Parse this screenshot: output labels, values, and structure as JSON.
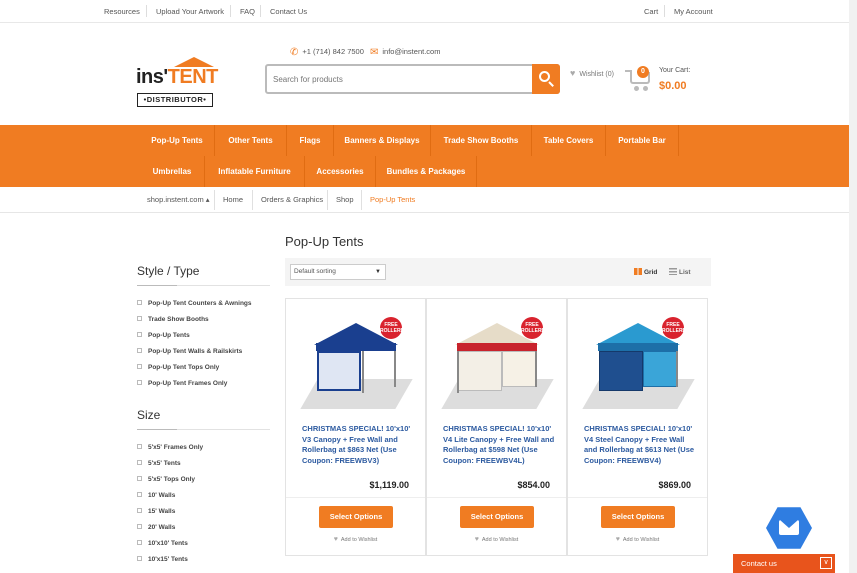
{
  "topbar": {
    "left_links": [
      "Resources",
      "Upload Your Artwork",
      "FAQ",
      "Contact Us"
    ],
    "right_links": [
      "Cart",
      "My Account"
    ]
  },
  "logo": {
    "part1": "ins'",
    "part2": "TENT",
    "sub": "•DISTRIBUTOR•"
  },
  "contact": {
    "phone": "+1 (714) 842 7500",
    "email": "info@instent.com"
  },
  "search": {
    "placeholder": "Search for products"
  },
  "wishlist": {
    "label": "Wishlist (0)"
  },
  "cart": {
    "count": "0",
    "label": "Your Cart:",
    "total": "$0.00"
  },
  "nav": {
    "row1": [
      "Pop-Up Tents",
      "Other Tents",
      "Flags",
      "Banners & Displays",
      "Trade Show Booths",
      "Table Covers",
      "Portable Bar"
    ],
    "row2": [
      "Umbrellas",
      "Inflatable Furniture",
      "Accessories",
      "Bundles & Packages"
    ]
  },
  "breadcrumb": [
    "shop.instent.com ▴",
    "Home",
    "Orders & Graphics",
    "Shop",
    "Pop-Up Tents"
  ],
  "sidebar": {
    "style_title": "Style / Type",
    "style_items": [
      "Pop-Up Tent Counters & Awnings",
      "Trade Show Booths",
      "Pop-Up Tents",
      "Pop-Up Tent Walls & Railskirts",
      "Pop-Up Tent Tops Only",
      "Pop-Up Tent Frames Only"
    ],
    "size_title": "Size",
    "size_items": [
      "5'x5' Frames Only",
      "5'x5' Tents",
      "5'x5' Tops Only",
      "10' Walls",
      "15' Walls",
      "20' Walls",
      "10'x10' Tents",
      "10'x15' Tents"
    ]
  },
  "content": {
    "title": "Pop-Up Tents",
    "sorting": "Default sorting",
    "view_grid": "Grid",
    "view_list": "List"
  },
  "products": [
    {
      "title": "CHRISTMAS SPECIAL! 10'x10' V3 Canopy + Free Wall and Rollerbag at $863 Net (Use Coupon: FREEWBV3)",
      "price": "$1,119.00",
      "button": "Select Options",
      "wishlist": "Add to Wishlist",
      "badge": "FREE ROLLERBAG!",
      "roof_color": "#1a3f8f"
    },
    {
      "title": "CHRISTMAS SPECIAL! 10'x10' V4 Lite Canopy + Free Wall and Rollerbag at $598 Net (Use Coupon: FREEWBV4L)",
      "price": "$854.00",
      "button": "Select Options",
      "wishlist": "Add to Wishlist",
      "badge": "FREE ROLLERBAG!",
      "roof_color": "#e6dcc8"
    },
    {
      "title": "CHRISTMAS SPECIAL! 10'x10' V4 Steel Canopy + Free Wall and Rollerbag at $613 Net (Use Coupon: FREEWBV4)",
      "price": "$869.00",
      "button": "Select Options",
      "wishlist": "Add to Wishlist",
      "badge": "FREE ROLLERBAG!",
      "roof_color": "#2a9ad0"
    }
  ],
  "floating": {
    "contact_label": "Contact us",
    "contact_chevron": "∨"
  },
  "colors": {
    "accent": "#f07c22",
    "link": "#2c5aa0",
    "contact": "#e8541c",
    "hex": "#2f7de1"
  }
}
